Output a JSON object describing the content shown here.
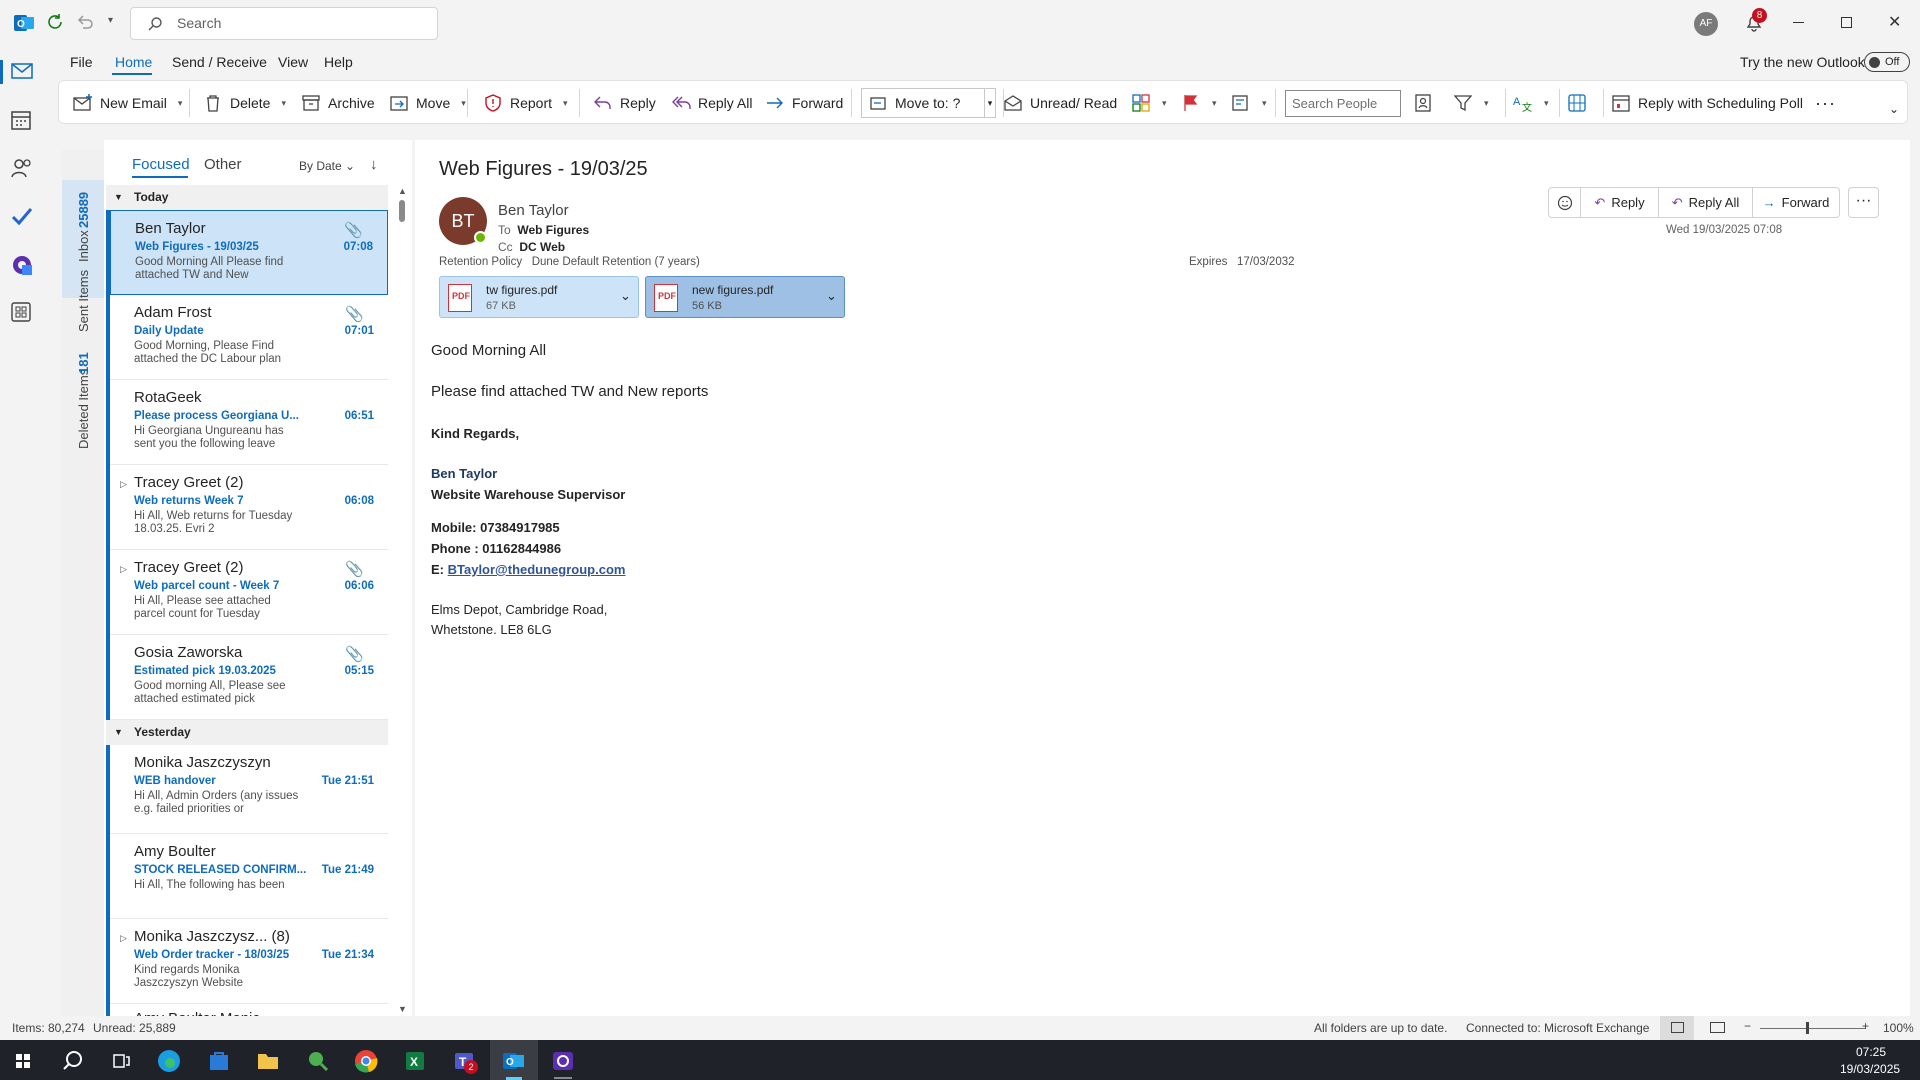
{
  "titlebar": {
    "search_placeholder": "Search",
    "avatar_initials": "AF",
    "notification_count": "8"
  },
  "menu": [
    "File",
    "Home",
    "Send / Receive",
    "View",
    "Help"
  ],
  "new_outlook": {
    "label": "Try the new Outlook",
    "toggle": "Off"
  },
  "ribbon": {
    "new_email": "New Email",
    "delete": "Delete",
    "archive": "Archive",
    "move": "Move",
    "report": "Report",
    "reply": "Reply",
    "reply_all": "Reply All",
    "forward": "Forward",
    "move_to": "Move to: ?",
    "unread_read": "Unread/ Read",
    "search_people_placeholder": "Search People",
    "reply_scheduling": "Reply with Scheduling Poll"
  },
  "folders": {
    "inbox": "Inbox",
    "inbox_count": "25889",
    "sent": "Sent Items",
    "deleted": "Deleted Items",
    "deleted_count": "181"
  },
  "list": {
    "tab_focused": "Focused",
    "tab_other": "Other",
    "sort": "By Date",
    "group_today": "Today",
    "group_yesterday": "Yesterday",
    "messages": [
      {
        "from": "Ben Taylor",
        "subject": "Web Figures - 19/03/25",
        "preview": "Good Morning All  Please find attached TW and New",
        "time": "07:08"
      },
      {
        "from": "Adam Frost",
        "subject": "Daily Update",
        "preview": "Good Morning,  Please Find attached the DC Labour plan",
        "time": "07:01"
      },
      {
        "from": "RotaGeek",
        "subject": "Please process Georgiana U...",
        "preview": "Hi Georgiana Ungureanu has sent you the following leave",
        "time": "06:51"
      },
      {
        "from": "Tracey Greet",
        "count": "(2)",
        "subject": "Web returns Week 7",
        "preview": "Hi All,  Web returns for Tuesday 18.03.25.  Evri 2",
        "time": "06:08"
      },
      {
        "from": "Tracey Greet",
        "count": "(2)",
        "subject": "Web parcel count - Week 7",
        "preview": "Hi All,  Please see attached parcel count for Tuesday",
        "time": "06:06"
      },
      {
        "from": "Gosia Zaworska",
        "subject": "Estimated pick 19.03.2025",
        "preview": "Good morning All,  Please see attached estimated pick",
        "time": "05:15"
      },
      {
        "from": "Monika Jaszczyszyn",
        "subject": "WEB handover",
        "preview": "Hi All,   Admin  Orders (any issues e.g. failed priorities or",
        "time": "Tue 21:51"
      },
      {
        "from": "Amy Boulter",
        "subject": "STOCK RELEASED CONFIRM...",
        "preview": "Hi All,  The following has been",
        "time": "Tue 21:49"
      },
      {
        "from": "Monika Jaszczysz...",
        "count": "(8)",
        "subject": "Web Order tracker - 18/03/25",
        "preview": "Kind regards  Monika Jaszczyszyn  Website",
        "time": "Tue 21:34"
      },
      {
        "from": "Amy Boulter  Monic",
        "subject": "",
        "preview": "",
        "time": ""
      }
    ]
  },
  "email": {
    "subject": "Web Figures - 19/03/25",
    "initials": "BT",
    "sender": "Ben Taylor",
    "to_label": "To",
    "to": "Web Figures",
    "cc_label": "Cc",
    "cc": "DC Web",
    "retention_label": "Retention Policy",
    "retention": "Dune Default Retention (7 years)",
    "expires_label": "Expires",
    "expires": "17/03/2032",
    "date": "Wed 19/03/2025 07:08",
    "actions": {
      "reply": "Reply",
      "reply_all": "Reply All",
      "forward": "Forward"
    },
    "attachments": [
      {
        "name": "tw figures.pdf",
        "size": "67 KB"
      },
      {
        "name": "new figures.pdf",
        "size": "56 KB"
      }
    ],
    "body_greeting": "Good Morning All",
    "body_line": "Please find attached TW and New reports",
    "sign_off": "Kind Regards,",
    "sig_name": "Ben Taylor",
    "sig_title": "Website Warehouse Supervisor",
    "sig_mobile": "Mobile: 07384917985",
    "sig_phone": "Phone : 01162844986",
    "sig_email_label": "E: ",
    "sig_email": "BTaylor@theduneg﻿roup.com",
    "sig_addr1": "Elms Depot, Cambridge Road,",
    "sig_addr2": "Whetstone. LE8 6LG"
  },
  "status": {
    "items": "Items: 80,274",
    "unread": "Unread: 25,889",
    "sync": "All folders are up to date.",
    "connected": "Connected to: Microsoft Exchange",
    "zoom": "100%"
  },
  "taskbar": {
    "time": "07:25",
    "date": "19/03/2025",
    "teams_badge": "2"
  }
}
